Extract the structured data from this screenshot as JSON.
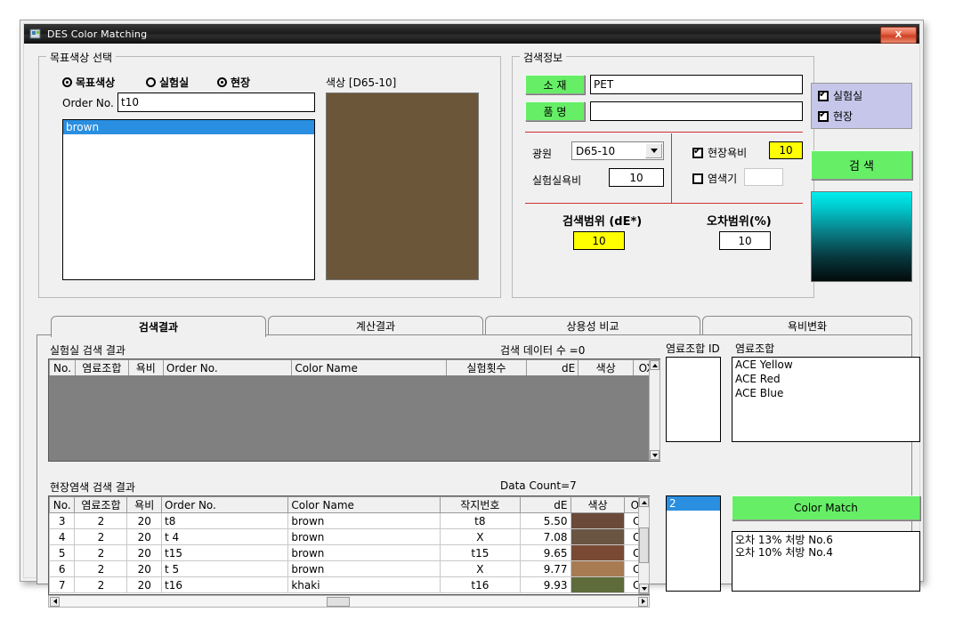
{
  "window": {
    "title": "DES Color Matching",
    "close_label": "X",
    "icon": "app-icon"
  },
  "target_group": {
    "legend": "목표색상 선택",
    "radios": [
      {
        "label": "목표색상",
        "selected": false
      },
      {
        "label": "실험실",
        "selected": false
      },
      {
        "label": "현장",
        "selected": true
      }
    ],
    "order_no_label": "Order No.",
    "order_no_value": "t10",
    "list_items": [
      "brown"
    ],
    "swatch_label": "색상 [D65-10]",
    "swatch_color": "#6B5639"
  },
  "search_info": {
    "legend": "검색정보",
    "material_btn": "소 재",
    "material_value": "PET",
    "product_btn": "품 명",
    "product_value": "",
    "light_source_label": "광원",
    "light_source_value": "D65-10",
    "lab_ratio_label": "실험실욕비",
    "lab_ratio_value": "10",
    "field_ratio_chk": "현장욕비",
    "field_ratio_checked": true,
    "field_ratio_value": "10",
    "dyeing_machine_chk": "염색기",
    "dyeing_machine_checked": false,
    "dyeing_machine_value": "",
    "search_range_label": "검색범위 (dE*)",
    "search_range_value": "10",
    "error_range_label": "오차범위(%)",
    "error_range_value": "10"
  },
  "right_panel": {
    "checks": [
      {
        "label": "실험실",
        "checked": true
      },
      {
        "label": "현장",
        "checked": true
      }
    ],
    "search_button": "검 색",
    "gradient_top": "#00EEEE",
    "gradient_bottom": "#020A0A"
  },
  "tabs": [
    {
      "label": "검색결과",
      "active": true
    },
    {
      "label": "계산결과",
      "active": false
    },
    {
      "label": "상용성 비교",
      "active": false
    },
    {
      "label": "욕비변화",
      "active": false
    }
  ],
  "lab_results": {
    "title": "실험실 검색 결과",
    "count_text": "검색 데이터 수 =0",
    "columns": [
      "No.",
      "염료조합",
      "욕비",
      "Order No.",
      "Color Name",
      "실험횟수",
      "dE",
      "색상",
      "OX"
    ],
    "rows": []
  },
  "dye_combo": {
    "id_label": "염료조합 ID",
    "combo_label": "염료조합",
    "id_items": [],
    "combo_items": [
      "ACE Yellow",
      "ACE Red",
      "ACE Blue"
    ]
  },
  "field_results": {
    "title": "현장염색 검색 결과",
    "count_text": "Data Count=7",
    "columns": [
      "No.",
      "염료조합",
      "욕비",
      "Order No.",
      "Color Name",
      "작지번호",
      "dE",
      "색상",
      "O:"
    ],
    "rows": [
      {
        "no": "3",
        "dye": "2",
        "ratio": "20",
        "order_no": "t8",
        "color_name": "brown",
        "job_no": "t8",
        "de": "5.50",
        "swatch": "#6B4A3A",
        "ox": "C"
      },
      {
        "no": "4",
        "dye": "2",
        "ratio": "20",
        "order_no": "t 4",
        "color_name": "brown",
        "job_no": "X",
        "de": "7.08",
        "swatch": "#6A5543",
        "ox": "C"
      },
      {
        "no": "5",
        "dye": "2",
        "ratio": "20",
        "order_no": "t15",
        "color_name": "brown",
        "job_no": "t15",
        "de": "9.65",
        "swatch": "#7A4934",
        "ox": "C"
      },
      {
        "no": "6",
        "dye": "2",
        "ratio": "20",
        "order_no": "t 5",
        "color_name": "brown",
        "job_no": "X",
        "de": "9.77",
        "swatch": "#A87B52",
        "ox": "C"
      },
      {
        "no": "7",
        "dye": "2",
        "ratio": "20",
        "order_no": "t16",
        "color_name": "khaki",
        "job_no": "t16",
        "de": "9.93",
        "swatch": "#5E6B3A",
        "ox": "C"
      }
    ]
  },
  "match_panel": {
    "selected_id": "2",
    "button": "Color Match",
    "notes": [
      "오차 13% 처방    No.6",
      "오차 10% 처방    No.4"
    ]
  }
}
